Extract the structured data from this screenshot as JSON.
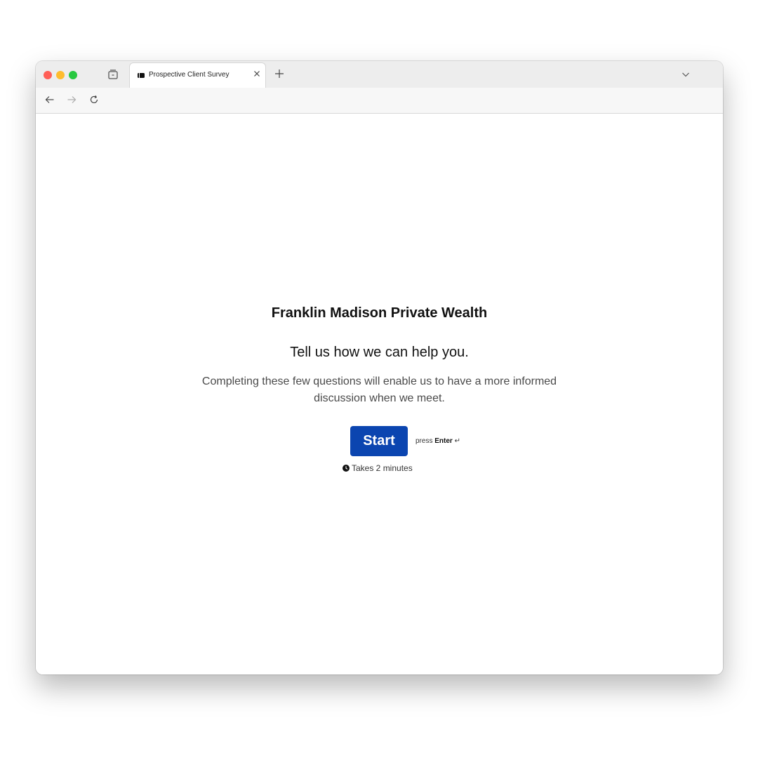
{
  "browser": {
    "tab": {
      "title": "Prospective Client Survey"
    },
    "icons": {
      "tab_overview": "tab-overview-icon",
      "favicon": "survey-favicon-icon",
      "close": "close-icon",
      "new_tab": "plus-icon",
      "tab_list": "chevron-down-icon",
      "back": "arrow-left-icon",
      "forward": "arrow-right-icon",
      "reload": "reload-icon"
    }
  },
  "survey": {
    "org_name": "Franklin Madison Private Wealth",
    "headline": "Tell us how we can help you.",
    "description": "Completing these few questions will enable us to have a more informed discussion when we meet.",
    "start_label": "Start",
    "hint_prefix": "press",
    "hint_key": "Enter",
    "hint_symbol": "↵",
    "duration_text": "Takes 2 minutes",
    "accent_color": "#0b45b0"
  }
}
